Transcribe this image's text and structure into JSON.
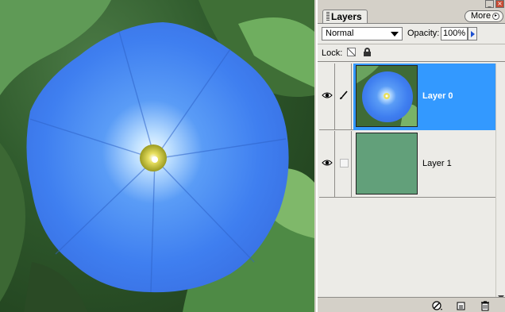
{
  "panel": {
    "tab_title": "Layers",
    "more_label": "More",
    "blend_mode": "Normal",
    "opacity_label": "Opacity:",
    "opacity_value": "100%",
    "lock_label": "Lock:"
  },
  "layers": [
    {
      "name": "Layer 0",
      "visible": true,
      "selected": true,
      "thumbnail": "morning-glory-flower"
    },
    {
      "name": "Layer 1",
      "visible": true,
      "selected": false,
      "thumbnail": "solid-green-fill",
      "fill_color": "#62a07a"
    }
  ],
  "icons": [
    "minimize-icon",
    "close-icon",
    "eye-icon",
    "brush-icon",
    "lock-transparency-icon",
    "lock-all-icon",
    "layer-style-icon",
    "new-layer-icon",
    "trash-icon"
  ],
  "colors": {
    "selection": "#3399ff",
    "flower_blue": "#3f7ff0",
    "layer1_fill": "#62a07a"
  }
}
